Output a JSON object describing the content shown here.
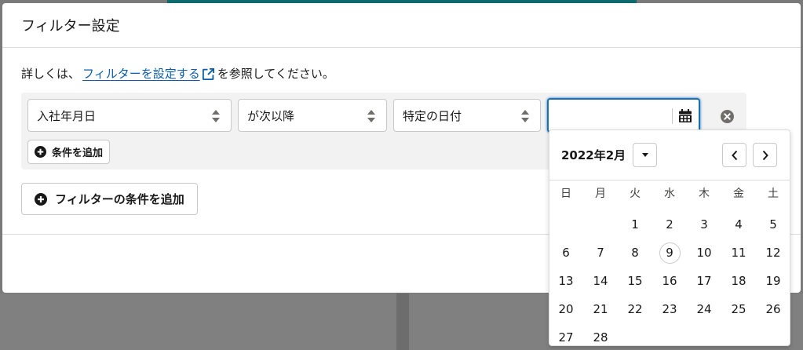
{
  "modal": {
    "title": "フィルター設定",
    "intro_before": "詳しくは、",
    "intro_link": "フィルターを設定する",
    "intro_after": "を参照してください。"
  },
  "condition": {
    "field": "入社年月日",
    "operator": "が次以降",
    "value_type": "特定の日付",
    "date_value": "",
    "add_condition_label": "条件を追加"
  },
  "add_filter_label": "フィルターの条件を追加",
  "datepicker": {
    "month_label": "2022年2月",
    "weekdays": [
      "日",
      "月",
      "火",
      "水",
      "木",
      "金",
      "土"
    ],
    "weeks": [
      [
        "",
        "",
        "1",
        "2",
        "3",
        "4",
        "5"
      ],
      [
        "6",
        "7",
        "8",
        "9",
        "10",
        "11",
        "12"
      ],
      [
        "13",
        "14",
        "15",
        "16",
        "17",
        "18",
        "19"
      ],
      [
        "20",
        "21",
        "22",
        "23",
        "24",
        "25",
        "26"
      ],
      [
        "27",
        "28",
        "",
        "",
        "",
        "",
        ""
      ]
    ],
    "today": "9"
  },
  "colors": {
    "link": "#0b5cab",
    "focus_border": "#1b6fb5",
    "page_top_bar": "#0d6b6f"
  },
  "icons": {
    "external_link": "external-link-icon",
    "select_arrows": "up-down-arrows-icon",
    "calendar": "calendar-icon",
    "remove": "close-circle-icon",
    "add": "plus-circle-icon",
    "chevron_down": "chevron-down-icon",
    "chevron_left": "chevron-left-icon",
    "chevron_right": "chevron-right-icon"
  }
}
